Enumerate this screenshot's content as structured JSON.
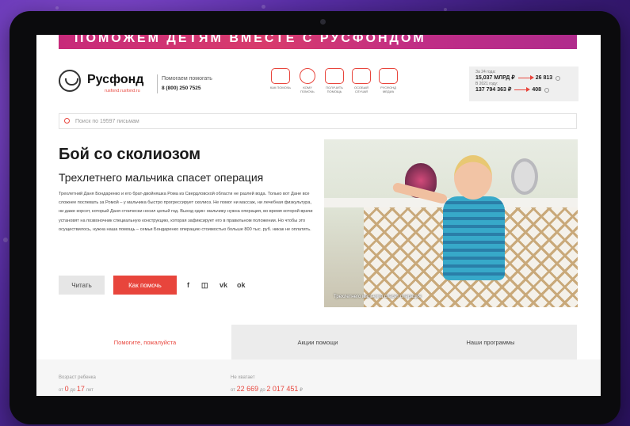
{
  "banner": {
    "text": "ПОМОЖЕМ ДЕТЯМ ВМЕСТЕ С РУСФОНДОМ"
  },
  "header": {
    "brand": "Русфонд",
    "site": "rusfond.rusfond.ru",
    "tagline": "Помогаем помогать",
    "phone": "8 (800) 250 7525"
  },
  "nav_icons": [
    {
      "label": "КАК ПОМОЧЬ",
      "icon": "card-icon"
    },
    {
      "label": "КОМУ ПОМОЧЬ",
      "icon": "face-icon"
    },
    {
      "label": "ПОЛУЧИТЬ ПОМОЩЬ",
      "icon": "hand-icon"
    },
    {
      "label": "ОСОБЫЙ СЛУЧАЙ",
      "icon": "heart-hand-icon"
    },
    {
      "label": "РУСФОНД МЕДИА",
      "icon": "media-icon"
    }
  ],
  "stats": {
    "label1": "За 24 года:",
    "amount1": "15,037 МЛРД ₽",
    "count1": "26 813",
    "label2": "В 2021 году:",
    "amount2": "137 794 363 ₽",
    "count2": "408"
  },
  "search": {
    "placeholder": "Поиск по 19597 письмам"
  },
  "story": {
    "title": "Бой со сколиозом",
    "subtitle": "Трехлетнего мальчика спасет операция",
    "body": "Трехлетний Даня Бондаренко и его брат-двойняшка Рома из Свердловской области не разлей вода. Только вот Дане все сложнее поспевать за Ромой – у мальчика быстро прогрессирует сколиоз. Не помог ни массаж, ни лечебная физкультура, ни даже корсет, который Даня стоически носил целый год. Выход один: мальчику нужна операция, во время которой врачи установят на позвоночник специальную конструкцию, которая зафиксирует его в правильном положении. Но чтобы это осуществилось, нужна наша помощь – семьи Бондаренко операцию стоимостью больше 800 тыс. руб. никак не оплатить.",
    "read_label": "Читать",
    "help_label": "Как помочь",
    "photo_caption": "Трехлетнего мальчика спасет операция"
  },
  "social": {
    "fb": "f",
    "ig": "◫",
    "vk": "vk",
    "ok": "ok"
  },
  "tabs": [
    {
      "label": "Помогите, пожалуйста"
    },
    {
      "label": "Акции помощи"
    },
    {
      "label": "Наши программы"
    }
  ],
  "filters": {
    "age_label": "Возраст ребенка",
    "age_from": "от",
    "age_min": "0",
    "age_to": "до",
    "age_max": "17",
    "age_unit": "лет",
    "need_label": "Не хватает",
    "need_from": "от",
    "need_min": "22 669",
    "need_to": "до",
    "need_max": "2 017 451",
    "need_unit": "₽"
  },
  "colors": {
    "accent": "#e8453c",
    "background": "#5a2fa8",
    "device": "#0b0b0d"
  }
}
